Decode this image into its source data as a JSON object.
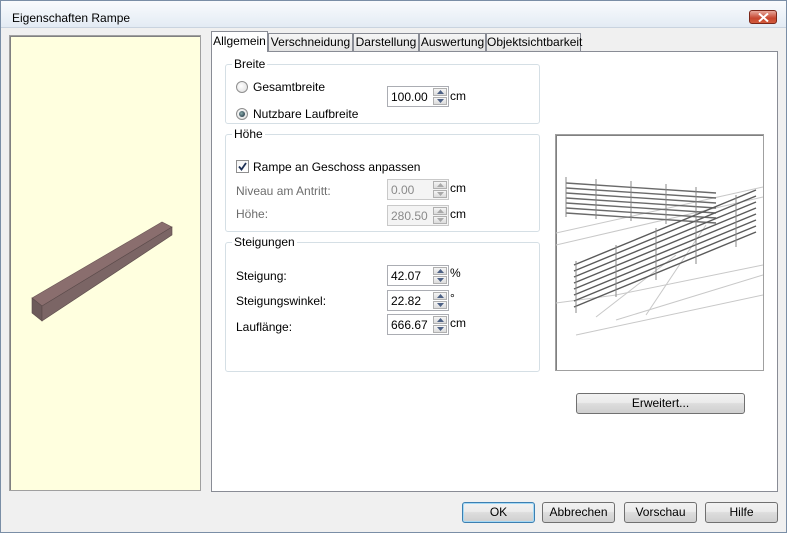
{
  "window": {
    "title": "Eigenschaften Rampe",
    "close_icon": "close-icon"
  },
  "tabs": [
    {
      "label": "Allgemein",
      "active": true
    },
    {
      "label": "Verschneidung",
      "active": false
    },
    {
      "label": "Darstellung",
      "active": false
    },
    {
      "label": "Auswertung",
      "active": false
    },
    {
      "label": "Objektsichtbarkeit",
      "active": false
    }
  ],
  "breite": {
    "title": "Breite",
    "option_gesamt": "Gesamtbreite",
    "option_nutzbar": "Nutzbare Laufbreite",
    "selected": "Nutzbare Laufbreite",
    "value": "100.00",
    "unit": "cm"
  },
  "hoehe": {
    "title": "Höhe",
    "checkbox_label": "Rampe an Geschoss anpassen",
    "checkbox_checked": true,
    "niveau_label": "Niveau am Antritt:",
    "niveau_value": "0.00",
    "niveau_unit": "cm",
    "hoehe_label": "Höhe:",
    "hoehe_value": "280.50",
    "hoehe_unit": "cm"
  },
  "steigungen": {
    "title": "Steigungen",
    "steigung_label": "Steigung:",
    "steigung_value": "42.07",
    "steigung_unit": "%",
    "winkel_label": "Steigungswinkel:",
    "winkel_value": "22.82",
    "winkel_unit": "°",
    "laufl_label": "Lauflänge:",
    "laufl_value": "666.67",
    "laufl_unit": "cm"
  },
  "buttons": {
    "erweitert": "Erweitert...",
    "ok": "OK",
    "abbrechen": "Abbrechen",
    "vorschau": "Vorschau",
    "hilfe": "Hilfe"
  },
  "colors": {
    "preview_bg": "#ffffdf",
    "ramp": "#8a6e6e",
    "accent_border": "#3c7fb1"
  }
}
